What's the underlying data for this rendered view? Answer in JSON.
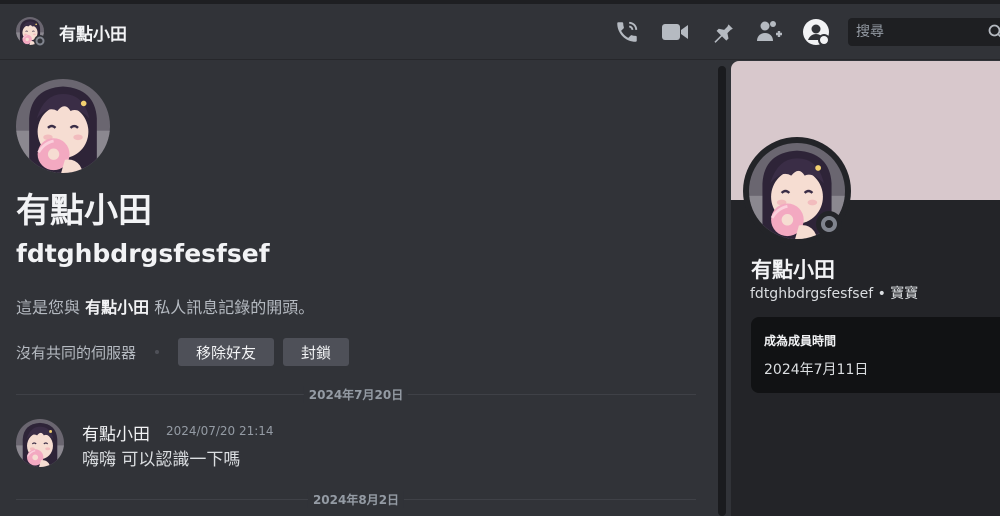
{
  "header": {
    "title": "有點小田",
    "icons": [
      "phone-call-icon",
      "video-call-icon",
      "pin-icon",
      "add-friends-to-dm-icon",
      "user-profile-icon",
      "search-icon"
    ],
    "search_placeholder": "搜尋"
  },
  "profile": {
    "display_name": "有點小田",
    "username": "fdtghbdrgsfesfsef",
    "intro_prefix": "這是您與 ",
    "intro_name": "有點小田",
    "intro_suffix": " 私人訊息記錄的開頭。",
    "mutual_servers": "沒有共同的伺服器",
    "remove_friend_label": "移除好友",
    "block_label": "封鎖"
  },
  "messages": {
    "dividers": [
      "2024年7月20日",
      "2024年8月2日"
    ],
    "items": [
      {
        "author": "有點小田",
        "timestamp": "2024/07/20 21:14",
        "text": "嗨嗨 可以認識一下嗎"
      }
    ]
  },
  "side_panel": {
    "display_name": "有點小田",
    "username_line": "fdtghbdrgsfesfsef • 寶寶",
    "member_since_title": "成為成員時間",
    "member_since_value": "2024年7月11日",
    "banner_color": "#d8c8cc",
    "status": "offline"
  },
  "colors": {
    "background": "#313338",
    "header_bg": "#313338",
    "panel_bg": "#232428",
    "button_bg": "#4e5058",
    "muted_text": "#b5bac1"
  }
}
